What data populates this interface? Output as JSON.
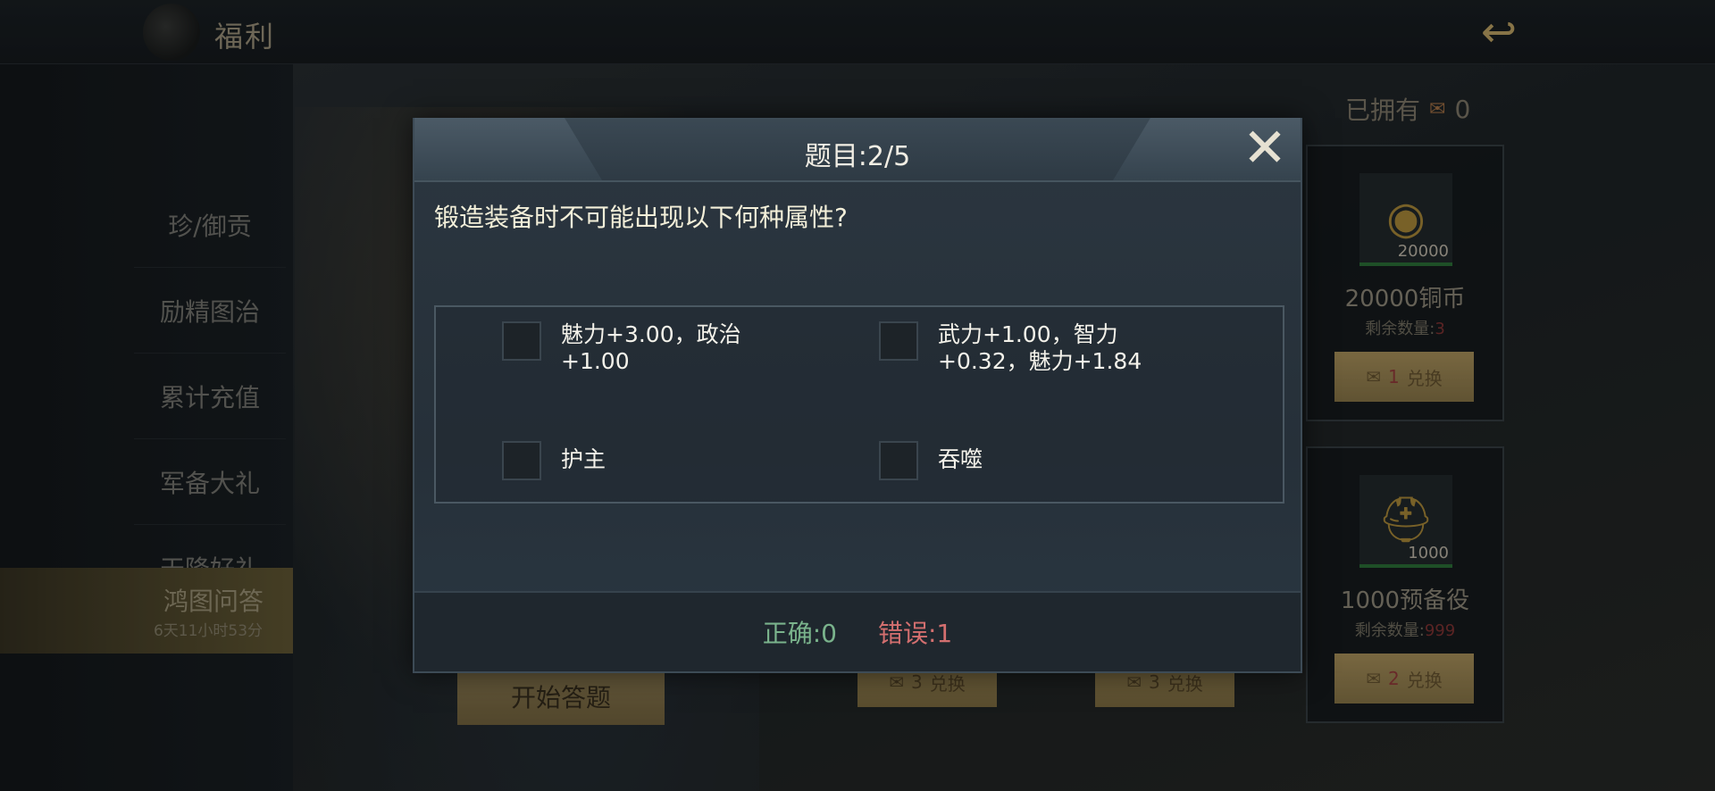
{
  "header": {
    "title": "福利",
    "back_icon": "dragon-back-icon"
  },
  "sidebar": {
    "items": [
      {
        "label": "珍/御贡"
      },
      {
        "label": "励精图治"
      },
      {
        "label": "累计充值"
      },
      {
        "label": "军备大礼"
      },
      {
        "label": "天降好礼"
      },
      {
        "label": "鸿图问答",
        "sub": "6天11小时53分",
        "active": true
      }
    ]
  },
  "shop": {
    "owned_label": "已拥有",
    "owned_count": "0",
    "cards": [
      {
        "icon": "copper-coin-icon",
        "qty": "20000",
        "name": "20000铜币",
        "remain_label": "剩余数量:",
        "remain": "3",
        "cost": "1",
        "exchange_label": "兑换"
      },
      {
        "icon": "reserve-soldier-icon",
        "qty": "1000",
        "name": "1000预备役",
        "remain_label": "剩余数量:",
        "remain": "999",
        "cost": "2",
        "exchange_label": "兑换"
      }
    ],
    "hidden_buttons": [
      {
        "cost": "3",
        "exchange_label": "兑换"
      },
      {
        "cost": "3",
        "exchange_label": "兑换"
      }
    ],
    "start_button": "开始答题"
  },
  "quiz": {
    "title": "题目:2/5",
    "question": "锻造装备时不可能出现以下何种属性?",
    "options": [
      {
        "label": "魅力+3.00，政治+1.00"
      },
      {
        "label": "武力+1.00，智力+0.32，魅力+1.84"
      },
      {
        "label": "护主"
      },
      {
        "label": "吞噬"
      }
    ],
    "correct_label": "正确:0",
    "wrong_label": "错误:1"
  },
  "colors": {
    "accent": "#d0b36e",
    "correct": "#7ab38c",
    "wrong": "#d36f6f"
  }
}
